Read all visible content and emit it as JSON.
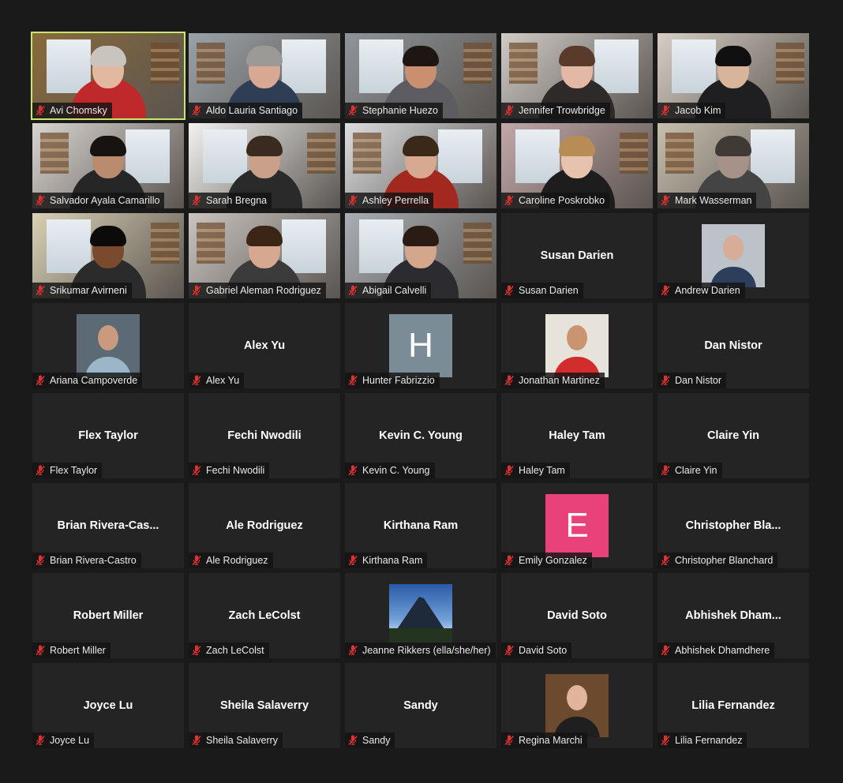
{
  "colors": {
    "active_border": "#c5e86c",
    "tile_bg": "#242424",
    "mute_icon": "#e0302f"
  },
  "participants": [
    {
      "name": "Avi Chomsky",
      "type": "video",
      "active": true,
      "bg": "#8a6a3a",
      "skin": "#e2b9a0",
      "shirt": "#c0292b",
      "hair": "#c9c4bd"
    },
    {
      "name": "Aldo Lauria Santiago",
      "type": "video",
      "bg": "#9aa2a8",
      "skin": "#d9a892",
      "shirt": "#2f3d55",
      "hair": "#9c9a96"
    },
    {
      "name": "Stephanie Huezo",
      "type": "video",
      "bg": "#8f949a",
      "skin": "#c98f6f",
      "shirt": "#5c5c62",
      "hair": "#1d1613"
    },
    {
      "name": "Jennifer Trowbridge",
      "type": "video",
      "bg": "#cfcac6",
      "skin": "#e3b8a5",
      "shirt": "#2e2a2a",
      "hair": "#5a3a2a"
    },
    {
      "name": "Jacob Kim",
      "type": "video",
      "bg": "#d6cfc5",
      "skin": "#d7b49a",
      "shirt": "#1f1f22",
      "hair": "#101010"
    },
    {
      "name": "Salvador Ayala Camarillo",
      "type": "video",
      "bg": "#d8d4cf",
      "skin": "#b98c6e",
      "shirt": "#262626",
      "hair": "#161311"
    },
    {
      "name": "Sarah Bregna",
      "type": "video",
      "bg": "#f2f2f0",
      "skin": "#c9a08a",
      "shirt": "#2a2a2a",
      "hair": "#3a2a20"
    },
    {
      "name": "Ashley Perrella",
      "type": "video",
      "bg": "#dcdde0",
      "skin": "#d7a990",
      "shirt": "#a22820",
      "hair": "#3a2818"
    },
    {
      "name": "Caroline Poskrobko",
      "type": "video",
      "bg": "#c2a7a8",
      "skin": "#e7c2ad",
      "shirt": "#1d1d1d",
      "hair": "#b88d55"
    },
    {
      "name": "Mark Wasserman",
      "type": "video",
      "bg": "#c7bfae",
      "skin": "#a7928a",
      "shirt": "#444",
      "hair": "#3f3a36"
    },
    {
      "name": "Srikumar Avirneni",
      "type": "video",
      "bg": "#d9d0b5",
      "skin": "#7a4a2e",
      "shirt": "#2b2b2b",
      "hair": "#0d0b0a"
    },
    {
      "name": "Gabriel Aleman Rodriguez",
      "type": "video",
      "bg": "#c9c4c0",
      "skin": "#d7a890",
      "shirt": "#3b3b3b",
      "hair": "#3a2516"
    },
    {
      "name": "Abigail Calvelli",
      "type": "video",
      "bg": "#a9aeb4",
      "skin": "#d4a68c",
      "shirt": "#2c2c30",
      "hair": "#2a1c14"
    },
    {
      "name": "Susan Darien",
      "type": "name",
      "display": "Susan Darien"
    },
    {
      "name": "Andrew Darien",
      "type": "photo",
      "photo_bg": "#bcc2c8",
      "skin": "#d7ad97",
      "shirt": "#2c3e5c"
    },
    {
      "name": "Ariana Campoverde",
      "type": "photo",
      "photo_bg": "#5b6a74",
      "skin": "#c99a7d",
      "shirt": "#9bb6c6"
    },
    {
      "name": "Alex Yu",
      "type": "name",
      "display": "Alex Yu"
    },
    {
      "name": "Hunter Fabrizzio",
      "type": "letter",
      "letter": "H",
      "color": "#7a8d96"
    },
    {
      "name": "Jonathan Martinez",
      "type": "photo",
      "photo_bg": "#e7e3da",
      "skin": "#c9946f",
      "shirt": "#d22d2d"
    },
    {
      "name": "Dan Nistor",
      "type": "name",
      "display": "Dan Nistor"
    },
    {
      "name": "Flex Taylor",
      "type": "name",
      "display": "Flex Taylor"
    },
    {
      "name": "Fechi Nwodili",
      "type": "name",
      "display": "Fechi Nwodili"
    },
    {
      "name": "Kevin C. Young",
      "type": "name",
      "display": "Kevin C. Young"
    },
    {
      "name": "Haley Tam",
      "type": "name",
      "display": "Haley Tam"
    },
    {
      "name": "Claire Yin",
      "type": "name",
      "display": "Claire Yin"
    },
    {
      "name": "Brian Rivera-Castro",
      "type": "name",
      "display": "Brian  Rivera-Cas..."
    },
    {
      "name": "Ale Rodriguez",
      "type": "name",
      "display": "Ale Rodriguez"
    },
    {
      "name": "Kirthana Ram",
      "type": "name",
      "display": "Kirthana Ram"
    },
    {
      "name": "Emily Gonzalez",
      "type": "letter",
      "letter": "E",
      "color": "#e9427a"
    },
    {
      "name": "Christopher Blanchard",
      "type": "name",
      "display": "Christopher  Bla..."
    },
    {
      "name": "Robert Miller",
      "type": "name",
      "display": "Robert Miller"
    },
    {
      "name": "Zach LeColst",
      "type": "name",
      "display": "Zach LeColst"
    },
    {
      "name": "Jeanne Rikkers (ella/she/her)",
      "type": "mountain"
    },
    {
      "name": "David Soto",
      "type": "name",
      "display": "David Soto"
    },
    {
      "name": "Abhishek Dhamdhere",
      "type": "name",
      "display": "Abhishek  Dham..."
    },
    {
      "name": "Joyce Lu",
      "type": "name",
      "display": "Joyce Lu"
    },
    {
      "name": "Sheila Salaverry",
      "type": "name",
      "display": "Sheila Salaverry"
    },
    {
      "name": "Sandy",
      "type": "name",
      "display": "Sandy"
    },
    {
      "name": "Regina Marchi",
      "type": "photo",
      "photo_bg": "#6b4a2e",
      "skin": "#e1b49b",
      "shirt": "#1f1f1f"
    },
    {
      "name": "Lilia Fernandez",
      "type": "name",
      "display": "Lilia Fernandez"
    }
  ]
}
